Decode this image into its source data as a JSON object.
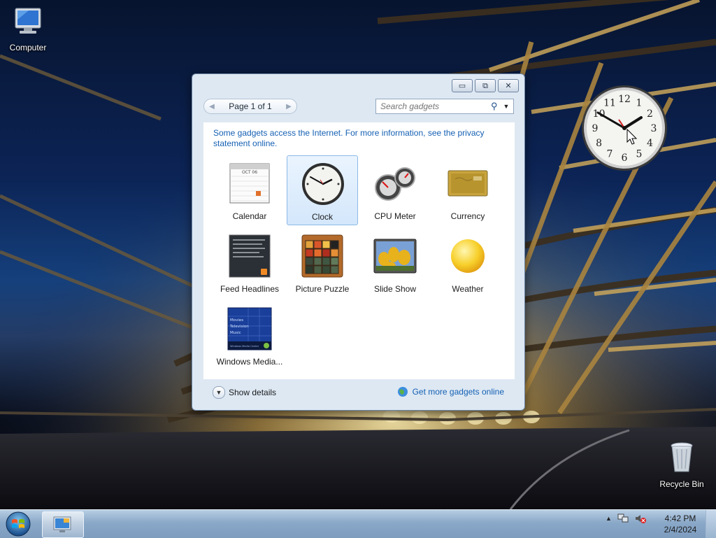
{
  "desktop": {
    "icons": [
      {
        "label": "Computer"
      },
      {
        "label": "Recycle Bin"
      }
    ]
  },
  "gadget_window": {
    "controls": {
      "minimize": "▭",
      "restore": "⧉",
      "close": "✕"
    },
    "pager": {
      "prev_icon": "◀",
      "label": "Page 1 of 1",
      "next_icon": "▶"
    },
    "search": {
      "placeholder": "Search gadgets",
      "icon": "⚲",
      "dropdown_icon": "▼"
    },
    "privacy_note": "Some gadgets access the Internet.  For more information, see the privacy statement online.",
    "gadgets": [
      {
        "label": "Calendar",
        "selected": false
      },
      {
        "label": "Clock",
        "selected": true
      },
      {
        "label": "CPU Meter",
        "selected": false
      },
      {
        "label": "Currency",
        "selected": false
      },
      {
        "label": "Feed Headlines",
        "selected": false
      },
      {
        "label": "Picture Puzzle",
        "selected": false
      },
      {
        "label": "Slide Show",
        "selected": false
      },
      {
        "label": "Weather",
        "selected": false
      },
      {
        "label": "Windows Media...",
        "selected": false
      }
    ],
    "calendar_thumb": {
      "month": "OCT 06"
    },
    "media_thumb": {
      "lines": [
        "Movies",
        "Television",
        "Music"
      ],
      "footer": "Windows Media Center"
    },
    "footer": {
      "show_details_icon": "▼",
      "show_details": "Show details",
      "more_online": "Get more gadgets online"
    }
  },
  "clock_gadget": {
    "numerals": [
      "12",
      "1",
      "2",
      "3",
      "4",
      "5",
      "6",
      "7",
      "8",
      "9",
      "10",
      "11"
    ]
  },
  "taskbar": {
    "tray_arrow": "▲",
    "time": "4:42 PM",
    "date": "2/4/2024"
  }
}
